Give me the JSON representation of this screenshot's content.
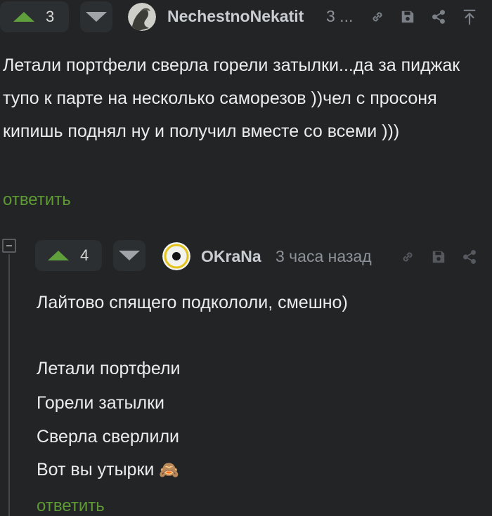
{
  "comment1": {
    "score": "3",
    "username": "NechestnoNekatit",
    "time": "3 ...",
    "body": "Летали портфели сверла горели затылки...да за пиджак тупо к парте на несколько саморезов ))чел с просоня кипишь поднял ну и получил вместе со всеми )))",
    "reply_label": "ответить",
    "icons": [
      "link-icon",
      "save-icon",
      "share-icon",
      "scroll-to-top-icon"
    ]
  },
  "comment2": {
    "score": "4",
    "username": "OKraNa",
    "time": "3 часа назад",
    "lines": [
      "Лайтово спящего подкололи, смешно)",
      "Летали портфели",
      "Горели затылки",
      "Сверла сверлили",
      "Вот вы утырки"
    ],
    "emoji": "🙈",
    "reply_label": "ответить",
    "icons": [
      "link-icon",
      "save-icon",
      "share-icon"
    ]
  },
  "colors": {
    "background": "#222426",
    "accent_green": "#5d9a34",
    "vote_up": "#5fa03c",
    "vote_down": "#a0a4a8",
    "username": "#c9cdd1",
    "muted": "#8e9399"
  }
}
